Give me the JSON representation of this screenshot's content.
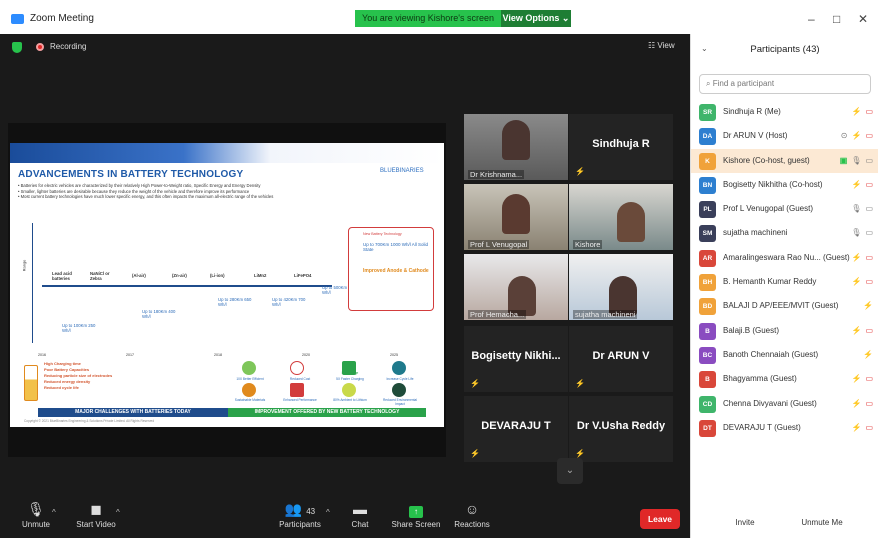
{
  "window": {
    "title": "Zoom Meeting",
    "viewing_banner": "You are viewing Kishore's screen",
    "view_options": "View Options ⌄",
    "minimize": "–",
    "maximize": "□",
    "close": "✕"
  },
  "meeting": {
    "recording_label": "Recording",
    "view_label": "☷ View"
  },
  "slide": {
    "title": "ADVANCEMENTS IN BATTERY TECHNOLOGY",
    "logo": "BLUEBINARIES",
    "bullet1": "• Batteries for electric vehicles are characterized by their relatively High Power-to-Weight ratio, Specific Energy and Energy Density",
    "bullet2": "• Smaller, lighter batteries are desirable because they reduce the weight of the vehicle and therefore improve its performance",
    "bullet3": "• Most current battery technologies have much lower specific energy, and this often impacts the maximum all-electric range of the vehicles",
    "range_label": "Range",
    "batteries": [
      "Lead acid batteries",
      "NaNiCl or Zebra",
      "(Al-air)",
      "(Zn-air)",
      "(Li-ion)",
      "LiMn2",
      "LiFePO4"
    ],
    "ranges": [
      "Up to 100Km 250 Wh/l",
      "Up to 180Km 400 Wh/l",
      "Up to 280Km 650 Wh/l",
      "Up to 420Km 700 Wh/l",
      "Up to 500Km 800 Wh/l"
    ],
    "future_title": "New Battery Technology",
    "future_range": "Up to 700Km 1000 Wh/l All Solid State",
    "future_improve": "Improved Anode & Cathode",
    "years": [
      "2016",
      "2017",
      "2018",
      "2020",
      "2025"
    ],
    "challenges": [
      "High Charging time",
      "Poor Battery Capacities",
      "Reducing particle size of electrodes",
      "Reduced energy density",
      "Reduced cycle life"
    ],
    "improvements": [
      "10X Better Efficient",
      "Reduced Cost",
      "FastCharge",
      "5X Faster Charging",
      "Increase Cycle Life",
      "Sustainable Materials",
      "Enhanced Performance",
      "80% Ambient to Lithium",
      "Reduced Environmental Impact"
    ],
    "bar_left": "MAJOR CHALLENGES WITH BATTERIES TODAY",
    "bar_right": "IMPROVEMENT OFFERED BY NEW BATTERY TECHNOLOGY",
    "copyright": "Copyright © 2021 BlueBinaries Engineering & Solutions Private Limited. All Rights Reserved"
  },
  "tiles": [
    {
      "name": "Dr Krishnama...",
      "type": "video"
    },
    {
      "name": "Sindhuja R",
      "type": "name"
    },
    {
      "name": "Prof L Venugopal",
      "type": "video"
    },
    {
      "name": "Kishore",
      "type": "video"
    },
    {
      "name": "Prof Hemacha...",
      "type": "video"
    },
    {
      "name": "sujatha machineni",
      "type": "video"
    },
    {
      "name": "Bogisetty Nikhi...",
      "type": "name"
    },
    {
      "name": "Dr ARUN V",
      "type": "name"
    },
    {
      "name": "DEVARAJU T",
      "type": "name"
    },
    {
      "name": "Dr V.Usha Reddy",
      "type": "name"
    }
  ],
  "toolbar": {
    "unmute": "Unmute",
    "start_video": "Start Video",
    "participants": "Participants",
    "participants_count": "43",
    "chat": "Chat",
    "share_screen": "Share Screen",
    "reactions": "Reactions",
    "leave": "Leave"
  },
  "panel": {
    "title": "Participants (43)",
    "search_placeholder": "Find a participant",
    "invite": "Invite",
    "unmute_me": "Unmute Me",
    "participants": [
      {
        "initials": "SR",
        "name": "Sindhuja R (Me)",
        "color": "#3fb56b",
        "mic": "off",
        "cam": "off"
      },
      {
        "initials": "DA",
        "name": "Dr ARUN V (Host)",
        "color": "#2d7fd0",
        "mic": "off",
        "cam": "off",
        "host": true
      },
      {
        "initials": "K",
        "name": "Kishore (Co-host, guest)",
        "color": "#f0a23a",
        "mic": "on",
        "cam": "on",
        "share": true,
        "highlight": true
      },
      {
        "initials": "BN",
        "name": "Bogisetty Nikhitha (Co-host)",
        "color": "#2d7fd0",
        "mic": "off",
        "cam": "off"
      },
      {
        "initials": "PL",
        "name": "Prof L Venugopal (Guest)",
        "color": "#3a3f5a",
        "mic": "on",
        "cam": "on"
      },
      {
        "initials": "SM",
        "name": "sujatha machineni",
        "color": "#3a3f5a",
        "mic": "on",
        "cam": "on"
      },
      {
        "initials": "AR",
        "name": "Amaralingeswara Rao Nu... (Guest)",
        "color": "#d9473a",
        "mic": "off",
        "cam": "off"
      },
      {
        "initials": "BH",
        "name": "B. Hemanth Kumar Reddy",
        "color": "#f0a23a",
        "mic": "off",
        "cam": "off"
      },
      {
        "initials": "BD",
        "name": "BALAJI D AP/EEE/MVIT (Guest)",
        "color": "#f0a23a",
        "mic": "off",
        "cam": "none"
      },
      {
        "initials": "B",
        "name": "Balaji.B (Guest)",
        "color": "#8a4cc0",
        "mic": "off",
        "cam": "off"
      },
      {
        "initials": "BC",
        "name": "Banoth Chennaiah (Guest)",
        "color": "#8a4cc0",
        "mic": "off",
        "cam": "none"
      },
      {
        "initials": "B",
        "name": "Bhagyamma (Guest)",
        "color": "#d9473a",
        "mic": "off",
        "cam": "off"
      },
      {
        "initials": "CD",
        "name": "Chenna Divyavani (Guest)",
        "color": "#3fb56b",
        "mic": "off",
        "cam": "off"
      },
      {
        "initials": "DT",
        "name": "DEVARAJU T (Guest)",
        "color": "#d9473a",
        "mic": "off",
        "cam": "off"
      }
    ]
  }
}
